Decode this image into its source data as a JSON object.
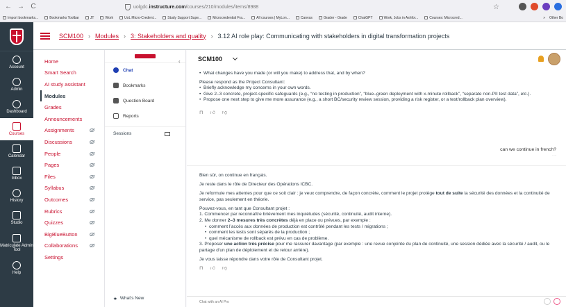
{
  "browser": {
    "url_prefix": "uolgdc.",
    "url_domain": "instructure.com",
    "url_path": "/courses/210/modules/items/8988",
    "back": "←",
    "forward": "→",
    "reload": "C"
  },
  "bookmarks": [
    "Import bookmarks...",
    "Bookmarks Toolbar",
    "JT",
    "Work",
    "UoL Micro-Credent...",
    "Study Support Supe...",
    "Microcredential Fra...",
    "All courses | MyLon...",
    "Canvas",
    "Grader - Grade",
    "ChatGPT",
    "Work, Jobs in Ashfor...",
    "Courses: Microcred..."
  ],
  "bookmarks_other": "Other Bo",
  "global_nav": [
    {
      "label": "Account",
      "icon": "account-icon"
    },
    {
      "label": "Admin",
      "icon": "admin-icon"
    },
    {
      "label": "Dashboard",
      "icon": "dashboard-icon"
    },
    {
      "label": "Courses",
      "icon": "courses-icon",
      "active": true
    },
    {
      "label": "Calendar",
      "icon": "calendar-icon"
    },
    {
      "label": "Inbox",
      "icon": "inbox-icon"
    },
    {
      "label": "History",
      "icon": "history-icon"
    },
    {
      "label": "Studio",
      "icon": "studio-icon"
    },
    {
      "label": "Matriculate Admin Tool",
      "icon": "matriculate-icon"
    },
    {
      "label": "Help",
      "icon": "help-icon"
    }
  ],
  "breadcrumb": {
    "course": "SCM100",
    "modules": "Modules",
    "module": "3: Stakeholders and quality",
    "current": "3.12 AI role play: Communicating with stakeholders in digital transformation projects",
    "sep": "›"
  },
  "course_nav": [
    {
      "label": "Home",
      "hidden": false
    },
    {
      "label": "Smart Search",
      "hidden": false
    },
    {
      "label": "AI study assistant",
      "hidden": false
    },
    {
      "label": "Modules",
      "hidden": false,
      "active": true
    },
    {
      "label": "Grades",
      "hidden": false
    },
    {
      "label": "Announcements",
      "hidden": false
    },
    {
      "label": "Assignments",
      "hidden": true
    },
    {
      "label": "Discussions",
      "hidden": true
    },
    {
      "label": "People",
      "hidden": true
    },
    {
      "label": "Pages",
      "hidden": true
    },
    {
      "label": "Files",
      "hidden": true
    },
    {
      "label": "Syllabus",
      "hidden": true
    },
    {
      "label": "Outcomes",
      "hidden": true
    },
    {
      "label": "Rubrics",
      "hidden": true
    },
    {
      "label": "Quizzes",
      "hidden": true
    },
    {
      "label": "BigBlueButton",
      "hidden": true
    },
    {
      "label": "Collaborations",
      "hidden": true
    },
    {
      "label": "Settings",
      "hidden": false
    }
  ],
  "chat_sidebar": {
    "items": [
      "Chat",
      "Bookmarks",
      "Question Board",
      "Reports"
    ],
    "sessions": "Sessions",
    "whats_new": "What's New"
  },
  "chat": {
    "course_title": "SCM100",
    "msg1": {
      "top_bullet": "What changes have you made (or will you make) to address that, and by when?",
      "intro": "Please respond as the Project Consultant:",
      "bullets": [
        "Briefly acknowledge my concerns in your own words.",
        "Give 2–3 concrete, project-specific safeguards (e.g., “no testing in production”, “blue–green deployment with x-minute rollback”, “separate non-PII test data”, etc.).",
        "Propose one next step to give me more assurance (e.g., a short BC/security review session, providing a risk register, or a test/rollback plan overview)."
      ]
    },
    "user_msg": "can we continue in french?",
    "msg2": {
      "p1": "Bien sûr, on continue en français.",
      "p2": "Je reste dans le rôle de Directeur des Opérations ICBC.",
      "p3_a": "Je reformule mes attentes pour que ce soit clair : je veux comprendre, de façon concrète, comment le projet protège ",
      "p3_b": "tout de suite",
      "p3_c": " la sécurité des données et la continuité de service, pas seulement en théorie.",
      "p4": "Pouvez-vous, en tant que Consultant projet :",
      "l1": "1. Commencer par reconnaître brièvement mes inquiétudes (sécurité, continuité, audit interne).",
      "l2_a": "2. Me donner ",
      "l2_b": "2–3 mesures très concrètes",
      "l2_c": " déjà en place ou prévues, par exemple :",
      "sub": [
        "comment l’accès aux données de production est contrôlé pendant les tests / migrations ;",
        "comment les tests sont séparés de la production ;",
        "quel mécanisme de rollback est prévu en cas de problème."
      ],
      "l3_a": "3. Proposer ",
      "l3_b": "une action très précise",
      "l3_c": " pour me rassurer davantage (par exemple : une revue conjointe du plan de continuité, une session dédiée avec la sécurité / audit, ou le partage d’un plan de déploiement et de retour arrière).",
      "p5": "Je vous laisse répondre dans votre rôle de Consultant projet."
    },
    "input_placeholder": "Chat with an AI Pro"
  },
  "colors": {
    "brand": "#c8102e",
    "nav_bg": "#2d3b45",
    "chat_accent": "#1f3fb3"
  }
}
